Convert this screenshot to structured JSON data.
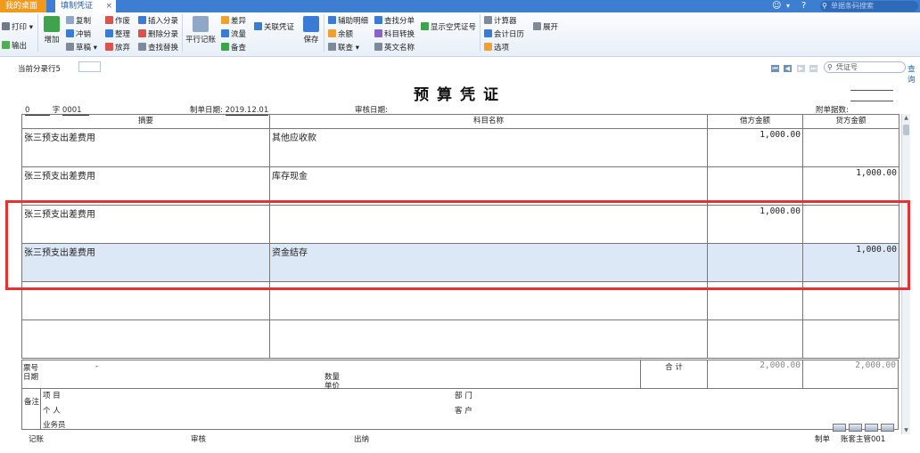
{
  "tabs": {
    "home": "我的桌面",
    "active": "填制凭证"
  },
  "top_search_placeholder": "单据条码搜索",
  "ribbon": {
    "print": "打印",
    "output": "输出",
    "add": "增加",
    "copy": "复制",
    "reverse": "冲销",
    "draft": "草稿",
    "void": "作废",
    "tidy": "整理",
    "discard": "放弃",
    "insert_entry": "插入分录",
    "delete_entry": "删除分录",
    "find_replace": "查找替换",
    "parallel": "平行记账",
    "difference": "差异",
    "flow": "流量",
    "backup": "备查",
    "link_voucher": "关联凭证",
    "save": "保存",
    "aux_detail": "辅助明细",
    "balance": "余额",
    "link_query": "联查",
    "find_entry": "查找分单",
    "subject_convert": "科目转换",
    "english_name": "英文名称",
    "show_empty_no": "显示空凭证号",
    "calculator": "计算器",
    "calendar": "会计日历",
    "options": "选项",
    "expand": "展开"
  },
  "current_row": "当前分录行5",
  "voucher_search_placeholder": "凭证号",
  "query_link": "查询",
  "voucher": {
    "title": "预算凭证",
    "number_prefix": "0",
    "number_label": "字",
    "number_value": "0001",
    "date_label": "制单日期:",
    "date_value": "2019.12.01",
    "audit_date_label": "审核日期:",
    "attachments_label": "附单据数:",
    "columns": {
      "summary": "摘要",
      "subject": "科目名称",
      "debit": "借方金额",
      "credit": "贷方金额"
    },
    "rows": [
      {
        "summary": "张三预支出差费用",
        "subject": "其他应收款",
        "debit": "1,000.00",
        "credit": ""
      },
      {
        "summary": "张三预支出差费用",
        "subject": "库存现金",
        "debit": "",
        "credit": "1,000.00"
      },
      {
        "summary": "张三预支出差费用",
        "subject": "",
        "debit": "1,000.00",
        "credit": ""
      },
      {
        "summary": "张三预支出差费用",
        "subject": "资金结存",
        "debit": "",
        "credit": "1,000.00"
      },
      {
        "summary": "",
        "subject": "",
        "debit": "",
        "credit": ""
      },
      {
        "summary": "",
        "subject": "",
        "debit": "",
        "credit": ""
      }
    ],
    "ticket_no_label": "票号",
    "ticket_dash": "-",
    "date_short_label": "日期",
    "quantity_label": "数量",
    "unit_price_label": "单价",
    "total_label": "合 计",
    "total_debit": "2,000.00",
    "total_credit": "2,000.00",
    "remarks_label": "备注",
    "project_label": "项  目",
    "person_label": "个  人",
    "salesman_label": "业务员",
    "dept_label": "部  门",
    "customer_label": "客  户",
    "bookkeeper_label": "记账",
    "auditor_label": "审核",
    "cashier_label": "出纳",
    "maker_label": "制单",
    "maker_name": "账套主管001"
  }
}
